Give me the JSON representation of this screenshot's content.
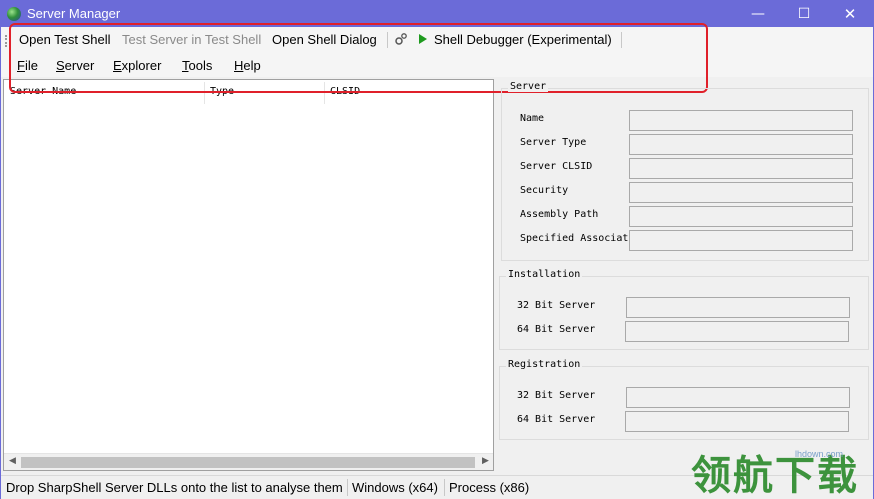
{
  "window": {
    "title": "Server Manager"
  },
  "toolbar": {
    "open_test_shell": "Open Test Shell",
    "test_server_in_test_shell": "Test Server in Test Shell",
    "open_shell_dialog": "Open Shell Dialog",
    "shell_debugger": "Shell Debugger (Experimental)"
  },
  "menu": {
    "file": {
      "u": "F",
      "rest": "ile"
    },
    "server": {
      "u": "S",
      "rest": "erver"
    },
    "explorer": {
      "u": "E",
      "rest": "xplorer"
    },
    "tools": {
      "u": "T",
      "rest": "ools"
    },
    "help": {
      "u": "H",
      "rest": "elp"
    }
  },
  "list": {
    "columns": [
      "Server Name",
      "Type",
      "CLSID"
    ],
    "rows": []
  },
  "server_group": {
    "title": "Server",
    "fields": [
      {
        "label": "Name",
        "value": ""
      },
      {
        "label": "Server Type",
        "value": ""
      },
      {
        "label": "Server CLSID",
        "value": ""
      },
      {
        "label": "Security",
        "value": ""
      },
      {
        "label": "Assembly Path",
        "value": ""
      },
      {
        "label": "Specified Associat",
        "value": ""
      }
    ]
  },
  "installation_group": {
    "title": "Installation",
    "fields": [
      {
        "label": "32 Bit Server",
        "value": ""
      },
      {
        "label": "64 Bit Server",
        "value": ""
      }
    ]
  },
  "registration_group": {
    "title": "Registration",
    "fields": [
      {
        "label": "32 Bit Server",
        "value": ""
      },
      {
        "label": "64 Bit Server",
        "value": ""
      }
    ]
  },
  "status": {
    "hint": "Drop SharpShell Server DLLs onto the list to analyse them",
    "windows": "Windows (x64)",
    "process": "Process (x86)"
  },
  "watermark": {
    "text": "领航下载",
    "url": "lhdown.com"
  },
  "colors": {
    "titlebar": "#6b6bd8",
    "highlight": "#e0202a",
    "play": "#1e9a1e"
  }
}
